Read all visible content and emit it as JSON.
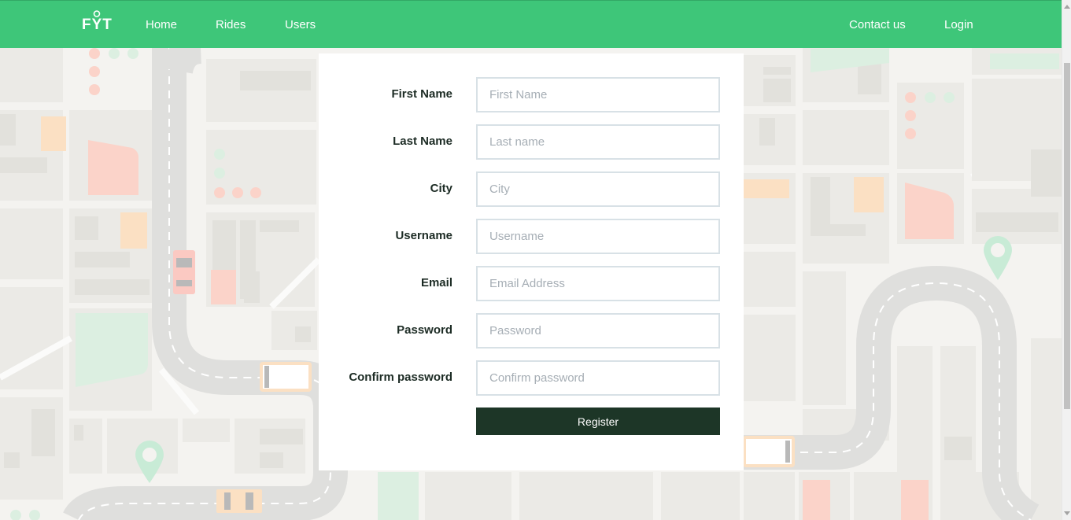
{
  "brand": {
    "logo_text": "FYT"
  },
  "nav": {
    "home": "Home",
    "rides": "Rides",
    "users": "Users",
    "contact": "Contact us",
    "login": "Login"
  },
  "form": {
    "fields": [
      {
        "label": "First Name",
        "placeholder": "First Name",
        "value": ""
      },
      {
        "label": "Last Name",
        "placeholder": "Last name",
        "value": ""
      },
      {
        "label": "City",
        "placeholder": "City",
        "value": ""
      },
      {
        "label": "Username",
        "placeholder": "Username",
        "value": ""
      },
      {
        "label": "Email",
        "placeholder": "Email Address",
        "value": ""
      },
      {
        "label": "Password",
        "placeholder": "Password",
        "value": ""
      },
      {
        "label": "Confirm password",
        "placeholder": "Confirm password",
        "value": ""
      }
    ],
    "submit_label": "Register"
  },
  "colors": {
    "navbar": "#3ec679",
    "button": "#1d3627",
    "map_background": "#f3f2ef"
  }
}
